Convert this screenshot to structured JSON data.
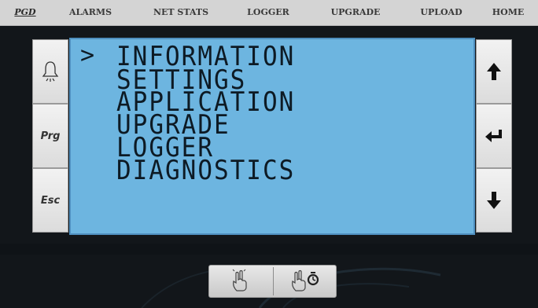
{
  "nav": {
    "items": [
      "PGD",
      "ALARMS",
      "NET STATS",
      "LOGGER",
      "UPGRADE",
      "UPLOAD",
      "HOME"
    ],
    "active_index": 0
  },
  "left_buttons": {
    "bell_icon": "bell-icon",
    "prg_label": "Prg",
    "esc_label": "Esc"
  },
  "right_buttons": {
    "up_icon": "arrow-up-icon",
    "enter_icon": "enter-icon",
    "down_icon": "arrow-down-icon"
  },
  "screen": {
    "cursor": ">",
    "menu": [
      "INFORMATION",
      "SETTINGS",
      "APPLICATION",
      "UPGRADE",
      "LOGGER",
      "DIAGNOSTICS"
    ]
  },
  "gestures": {
    "left_icon": "two-finger-tap-icon",
    "right_icon": "two-finger-hold-icon"
  },
  "colors": {
    "lcd_background": "#6db5e0",
    "nav_background": "#d4d4d4",
    "page_background": "#12161a"
  }
}
